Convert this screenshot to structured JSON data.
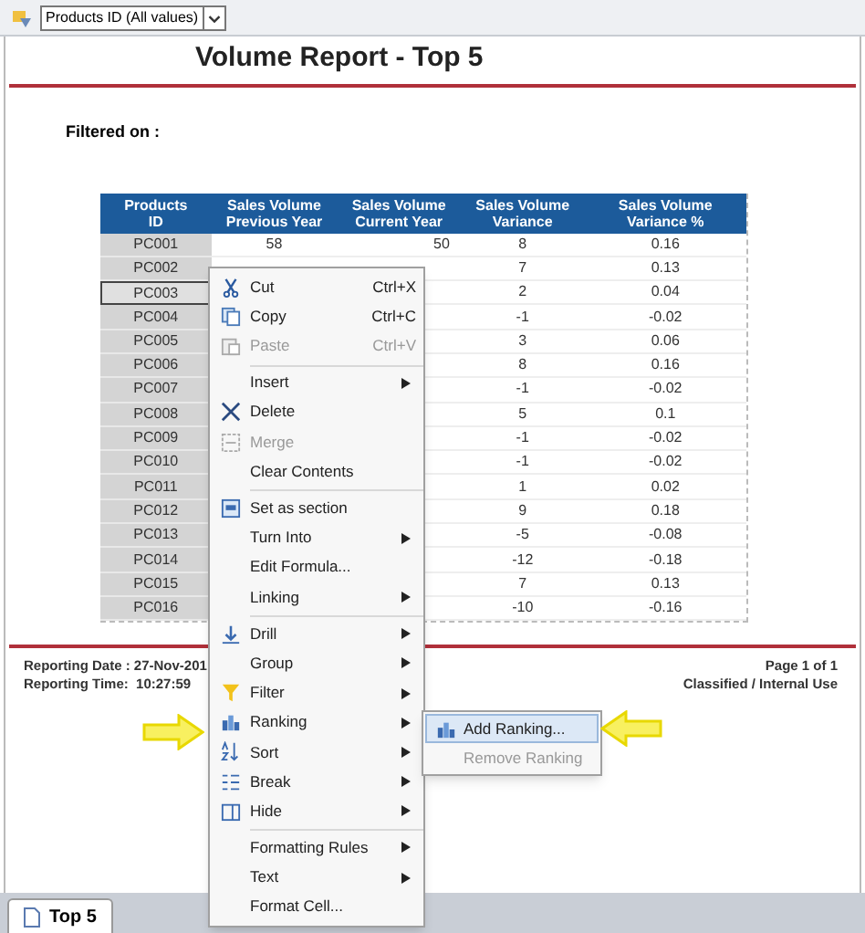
{
  "toolbar": {
    "filter_dropdown": {
      "value": "Products ID (All values)"
    }
  },
  "report": {
    "title": "Volume Report - Top 5",
    "filter_label": "Filtered on  :",
    "table": {
      "columns": [
        "Products ID",
        "Sales Volume Previous Year",
        "Sales Volume Current Year",
        "Sales Volume Variance",
        "Sales Volume Variance %"
      ],
      "rows": [
        {
          "id": "PC001",
          "previous_year": "58",
          "current_year": "50",
          "variance": "8",
          "variance_pct": "0.16",
          "selected": false
        },
        {
          "id": "PC002",
          "variance": "7",
          "variance_pct": "0.13",
          "selected": false
        },
        {
          "id": "PC003",
          "variance": "2",
          "variance_pct": "0.04",
          "selected": true
        },
        {
          "id": "PC004",
          "variance": "-1",
          "variance_pct": "-0.02",
          "selected": false
        },
        {
          "id": "PC005",
          "variance": "3",
          "variance_pct": "0.06",
          "selected": false
        },
        {
          "id": "PC006",
          "variance": "8",
          "variance_pct": "0.16",
          "selected": false
        },
        {
          "id": "PC007",
          "variance": "-1",
          "variance_pct": "-0.02",
          "selected": false
        },
        {
          "id": "PC008",
          "variance": "5",
          "variance_pct": "0.1",
          "selected": false
        },
        {
          "id": "PC009",
          "variance": "-1",
          "variance_pct": "-0.02",
          "selected": false
        },
        {
          "id": "PC010",
          "variance": "-1",
          "variance_pct": "-0.02",
          "selected": false
        },
        {
          "id": "PC011",
          "variance": "1",
          "variance_pct": "0.02",
          "selected": false
        },
        {
          "id": "PC012",
          "variance": "9",
          "variance_pct": "0.18",
          "selected": false
        },
        {
          "id": "PC013",
          "variance": "-5",
          "variance_pct": "-0.08",
          "selected": false
        },
        {
          "id": "PC014",
          "variance": "-12",
          "variance_pct": "-0.18",
          "selected": false
        },
        {
          "id": "PC015",
          "variance": "7",
          "variance_pct": "0.13",
          "selected": false
        },
        {
          "id": "PC016",
          "variance": "-10",
          "variance_pct": "-0.16",
          "selected": false
        }
      ]
    },
    "footer": {
      "reporting_date": "Reporting Date : 27-Nov-201",
      "reporting_time": "Reporting Time:  10:27:59",
      "page": "Page 1 of 1",
      "classification": "Classified / Internal Use"
    }
  },
  "context_menu": [
    {
      "kind": "item",
      "label": "Cut",
      "shortcut": "Ctrl+X",
      "disabled": false,
      "submenu": false
    },
    {
      "kind": "item",
      "label": "Copy",
      "shortcut": "Ctrl+C",
      "disabled": false,
      "submenu": false
    },
    {
      "kind": "item",
      "label": "Paste",
      "shortcut": "Ctrl+V",
      "disabled": true,
      "submenu": false
    },
    {
      "kind": "separator"
    },
    {
      "kind": "item",
      "label": "Insert",
      "disabled": false,
      "submenu": true
    },
    {
      "kind": "item",
      "label": "Delete",
      "disabled": false,
      "submenu": false
    },
    {
      "kind": "item",
      "label": "Merge",
      "disabled": true,
      "submenu": false
    },
    {
      "kind": "item",
      "label": "Clear Contents",
      "disabled": false,
      "submenu": false
    },
    {
      "kind": "separator"
    },
    {
      "kind": "item",
      "label": "Set as section",
      "disabled": false,
      "submenu": false
    },
    {
      "kind": "item",
      "label": "Turn Into",
      "disabled": false,
      "submenu": true
    },
    {
      "kind": "item",
      "label": "Edit Formula...",
      "disabled": false,
      "submenu": false
    },
    {
      "kind": "item",
      "label": "Linking",
      "disabled": false,
      "submenu": true
    },
    {
      "kind": "separator"
    },
    {
      "kind": "item",
      "label": "Drill",
      "disabled": false,
      "submenu": true
    },
    {
      "kind": "item",
      "label": "Group",
      "disabled": false,
      "submenu": true
    },
    {
      "kind": "item",
      "label": "Filter",
      "disabled": false,
      "submenu": true
    },
    {
      "kind": "item",
      "label": "Ranking",
      "disabled": false,
      "submenu": true
    },
    {
      "kind": "item",
      "label": "Sort",
      "disabled": false,
      "submenu": true
    },
    {
      "kind": "item",
      "label": "Break",
      "disabled": false,
      "submenu": true
    },
    {
      "kind": "item",
      "label": "Hide",
      "disabled": false,
      "submenu": true
    },
    {
      "kind": "separator"
    },
    {
      "kind": "item",
      "label": "Formatting Rules",
      "disabled": false,
      "submenu": true
    },
    {
      "kind": "item",
      "label": "Text",
      "disabled": false,
      "submenu": true
    },
    {
      "kind": "item",
      "label": "Format Cell...",
      "disabled": false,
      "submenu": false
    }
  ],
  "submenu": [
    {
      "label": "Add Ranking...",
      "disabled": false,
      "selected": true
    },
    {
      "label": "Remove Ranking",
      "disabled": true,
      "selected": false
    }
  ],
  "tabs": [
    {
      "label": "Top 5",
      "selected": true
    }
  ]
}
